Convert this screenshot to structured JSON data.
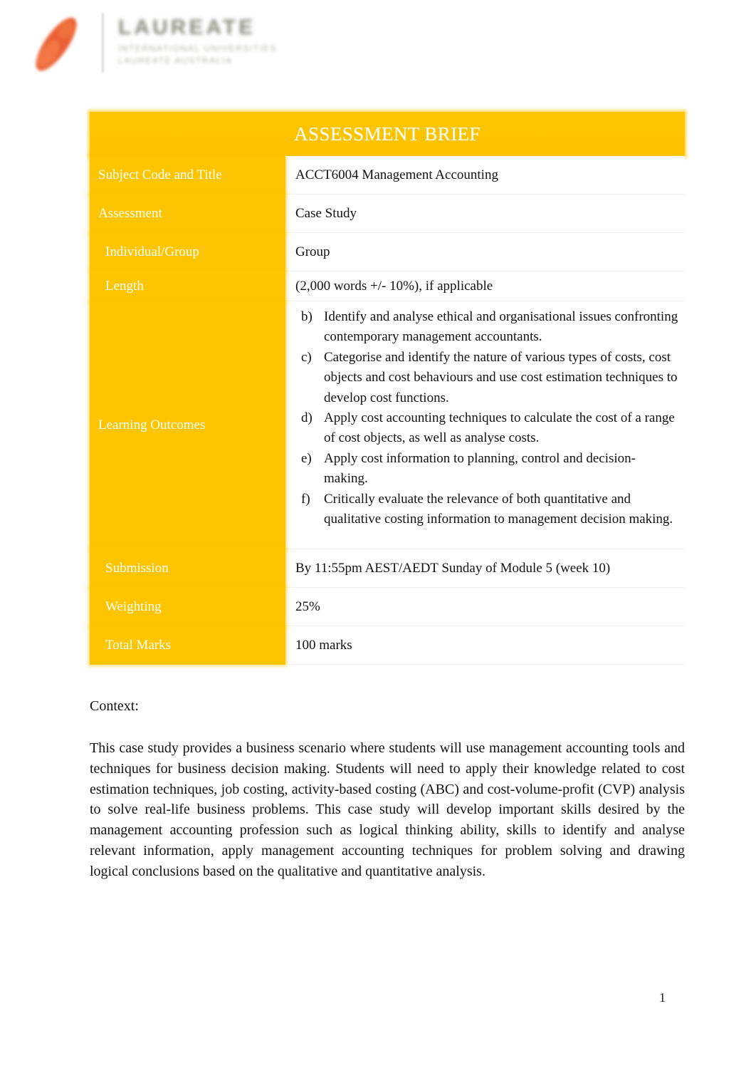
{
  "logo": {
    "wordmark": "LAUREATE",
    "tagline_line1": "INTERNATIONAL UNIVERSITIES",
    "tagline_line2": "LAUREATE AUSTRALIA",
    "mark_color": "#e8592a",
    "wordmark_color": "#8a8a80"
  },
  "colors": {
    "accent_yellow": "#fdc500",
    "header_text": "#ffffff",
    "body_text": "#111111"
  },
  "table": {
    "title": "ASSESSMENT BRIEF",
    "rows": [
      {
        "label": "Subject Code and Title",
        "value": "ACCT6004 Management Accounting"
      },
      {
        "label": "Assessment",
        "value": "Case Study"
      },
      {
        "label": "Individual/Group",
        "value": "Group"
      },
      {
        "label": "Length",
        "value": "(2,000 words +/- 10%), if applicable"
      },
      {
        "label": "Learning Outcomes",
        "value": ""
      },
      {
        "label": "Submission",
        "value": "By 11:55pm AEST/AEDT Sunday of Module 5 (week 10)"
      },
      {
        "label": "Weighting",
        "value": "25%"
      },
      {
        "label": "Total Marks",
        "value": "100 marks"
      }
    ],
    "learning_outcomes": [
      {
        "marker": "b)",
        "text": "Identify and analyse ethical and organisational issues confronting contemporary management accountants."
      },
      {
        "marker": "c)",
        "text": "Categorise and identify the nature of various types of costs, cost objects and cost behaviours and use cost estimation techniques to develop cost functions."
      },
      {
        "marker": "d)",
        "text": "Apply cost accounting techniques to calculate the cost of a range of cost objects, as well as analyse costs."
      },
      {
        "marker": "e)",
        "text": "Apply cost information to planning, control and decision-making."
      },
      {
        "marker": "f)",
        "text": "Critically evaluate the relevance of both quantitative and qualitative costing information to management decision making."
      }
    ]
  },
  "context": {
    "heading": "Context:",
    "paragraph": "This case study provides a business scenario where students will use management accounting tools and techniques for business decision making. Students will need to apply their knowledge related to cost estimation techniques, job costing, activity-based costing (ABC) and cost-volume-profit (CVP) analysis to solve real-life business problems. This case study will develop important skills desired by the management accounting profession such as logical thinking ability, skills to identify and analyse relevant information, apply management accounting techniques for problem solving and drawing logical conclusions based on the qualitative and quantitative analysis."
  },
  "footer": {
    "page_number": "1"
  }
}
